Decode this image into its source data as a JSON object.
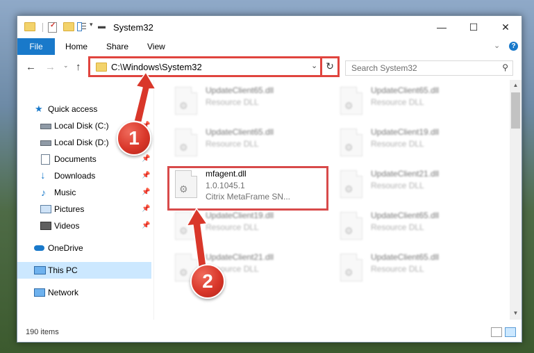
{
  "window": {
    "title": "System32",
    "controls": {
      "minimize": "—",
      "maximize": "☐",
      "close": "✕"
    }
  },
  "ribbon": {
    "tabs": [
      {
        "label": "File",
        "active": true
      },
      {
        "label": "Home"
      },
      {
        "label": "Share"
      },
      {
        "label": "View"
      }
    ],
    "help": "?"
  },
  "address": {
    "path": "C:\\Windows\\System32",
    "search_placeholder": "Search System32"
  },
  "navigation": {
    "items": [
      {
        "label": "Quick access",
        "icon": "star-icon",
        "pinned": false
      },
      {
        "label": "Local Disk (C:)",
        "icon": "drive-icon",
        "pinned": true
      },
      {
        "label": "Local Disk (D:)",
        "icon": "drive-icon",
        "pinned": true
      },
      {
        "label": "Documents",
        "icon": "documents-icon",
        "pinned": true
      },
      {
        "label": "Downloads",
        "icon": "download-icon",
        "pinned": true
      },
      {
        "label": "Music",
        "icon": "music-icon",
        "pinned": true
      },
      {
        "label": "Pictures",
        "icon": "pictures-icon",
        "pinned": true
      },
      {
        "label": "Videos",
        "icon": "videos-icon",
        "pinned": true
      },
      {
        "label": "OneDrive",
        "icon": "cloud-icon",
        "pinned": false
      },
      {
        "label": "This PC",
        "icon": "computer-icon",
        "pinned": false,
        "selected": true
      },
      {
        "label": "Network",
        "icon": "network-icon",
        "pinned": false
      }
    ]
  },
  "files": {
    "left_column": [
      {
        "name": "UpdateClient65.dll",
        "type": "Resource DLL",
        "blurred": true
      },
      {
        "name": "UpdateClient65.dll",
        "type": "Resource DLL",
        "blurred": true
      },
      {
        "name": "mfagent.dll",
        "version": "1.0.1045.1",
        "description": "Citrix MetaFrame SN...",
        "blurred": false,
        "highlighted": true
      },
      {
        "name": "UpdateClient19.dll",
        "type": "Resource DLL",
        "blurred": true
      },
      {
        "name": "UpdateClient21.dll",
        "type": "Resource DLL",
        "blurred": true
      }
    ],
    "right_column": [
      {
        "name": "UpdateClient65.dll",
        "type": "Resource DLL",
        "blurred": true
      },
      {
        "name": "UpdateClient19.dll",
        "type": "Resource DLL",
        "blurred": true
      },
      {
        "name": "UpdateClient21.dll",
        "type": "Resource DLL",
        "blurred": true
      },
      {
        "name": "UpdateClient65.dll",
        "type": "Resource DLL",
        "blurred": true
      },
      {
        "name": "UpdateClient65.dll",
        "type": "Resource DLL",
        "blurred": true
      }
    ]
  },
  "status": {
    "item_count": "190 items"
  },
  "annotations": {
    "step1": "1",
    "step2": "2",
    "color": "#d9372a"
  }
}
